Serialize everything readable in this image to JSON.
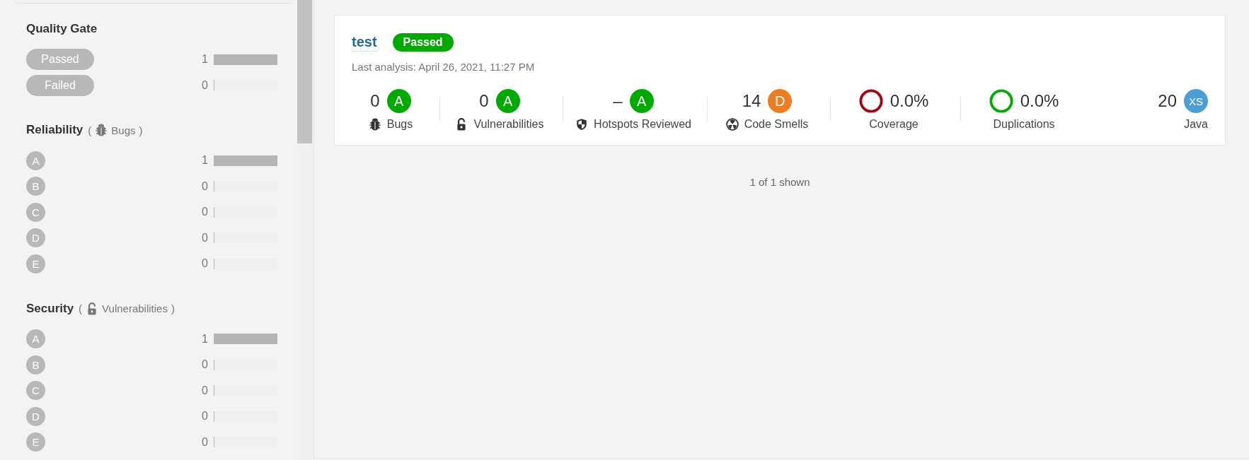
{
  "sidebar": {
    "sections": [
      {
        "kind": "gate",
        "title": "Quality Gate",
        "facets": [
          {
            "label": "Passed",
            "count": "1",
            "level": 1
          },
          {
            "label": "Failed",
            "count": "0",
            "level": 0
          }
        ]
      },
      {
        "kind": "reliability",
        "title": "Reliability",
        "open": "(",
        "subtitle": "Bugs",
        "close": ")",
        "facets": [
          {
            "label": "A",
            "count": "1",
            "level": 1
          },
          {
            "label": "B",
            "count": "0",
            "level": 0
          },
          {
            "label": "C",
            "count": "0",
            "level": 0
          },
          {
            "label": "D",
            "count": "0",
            "level": 0
          },
          {
            "label": "E",
            "count": "0",
            "level": 0
          }
        ]
      },
      {
        "kind": "security",
        "title": "Security",
        "open": "(",
        "subtitle": "Vulnerabilities",
        "close": ")",
        "facets": [
          {
            "label": "A",
            "count": "1",
            "level": 1
          },
          {
            "label": "B",
            "count": "0",
            "level": 0
          },
          {
            "label": "C",
            "count": "0",
            "level": 0
          },
          {
            "label": "D",
            "count": "0",
            "level": 0
          },
          {
            "label": "E",
            "count": "0",
            "level": 0
          }
        ]
      }
    ]
  },
  "projects": [
    {
      "name": "test",
      "gate": "Passed",
      "gate_passed": true,
      "last_analysis": "Last analysis: April 26, 2021, 11:27 PM",
      "measures": [
        {
          "kind": "bugs",
          "value": "0",
          "rating": "A",
          "color": "#00aa00",
          "label": "Bugs"
        },
        {
          "kind": "vulnerabilities",
          "value": "0",
          "rating": "A",
          "color": "#00aa00",
          "label": "Vulnerabilities"
        },
        {
          "kind": "hotspots",
          "value": "–",
          "rating": "A",
          "color": "#00aa00",
          "label": "Hotspots Reviewed"
        },
        {
          "kind": "smells",
          "value": "14",
          "rating": "D",
          "color": "#ed7d20",
          "label": "Code Smells"
        },
        {
          "kind": "coverage",
          "value": "0.0%",
          "color": "#a4030f",
          "label": "Coverage"
        },
        {
          "kind": "duplications",
          "value": "0.0%",
          "color": "#00aa00",
          "label": "Duplications"
        },
        {
          "kind": "size",
          "value": "20",
          "rating": "XS",
          "color": "#4b9fd5",
          "label": "Java"
        }
      ]
    }
  ],
  "footer": "1 of 1 shown"
}
